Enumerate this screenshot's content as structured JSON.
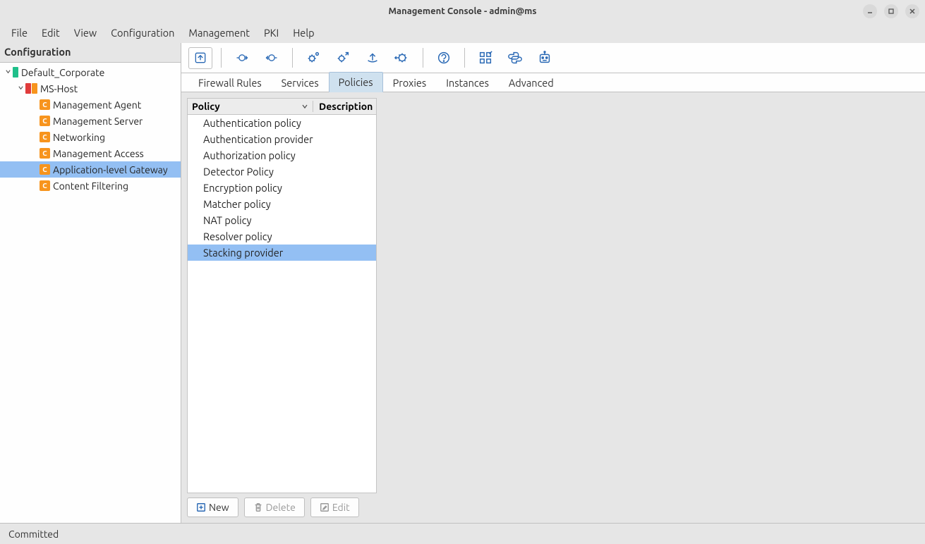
{
  "window": {
    "title": "Management Console - admin@ms"
  },
  "menubar": [
    "File",
    "Edit",
    "View",
    "Configuration",
    "Management",
    "PKI",
    "Help"
  ],
  "sidebar": {
    "header": "Configuration",
    "root_label": "Default_Corporate",
    "host_label": "MS-Host",
    "children": [
      "Management Agent",
      "Management Server",
      "Networking",
      "Management Access",
      "Application-level Gateway",
      "Content Filtering"
    ],
    "selected_index": 4
  },
  "tabs": [
    "Firewall Rules",
    "Services",
    "Policies",
    "Proxies",
    "Instances",
    "Advanced"
  ],
  "active_tab_index": 2,
  "list": {
    "col1": "Policy",
    "col2": "Description",
    "rows": [
      "Authentication policy",
      "Authentication provider",
      "Authorization policy",
      "Detector Policy",
      "Encryption policy",
      "Matcher policy",
      "NAT policy",
      "Resolver policy",
      "Stacking provider"
    ],
    "selected_index": 8
  },
  "actions": {
    "new": "New",
    "delete": "Delete",
    "edit": "Edit"
  },
  "status": "Committed"
}
